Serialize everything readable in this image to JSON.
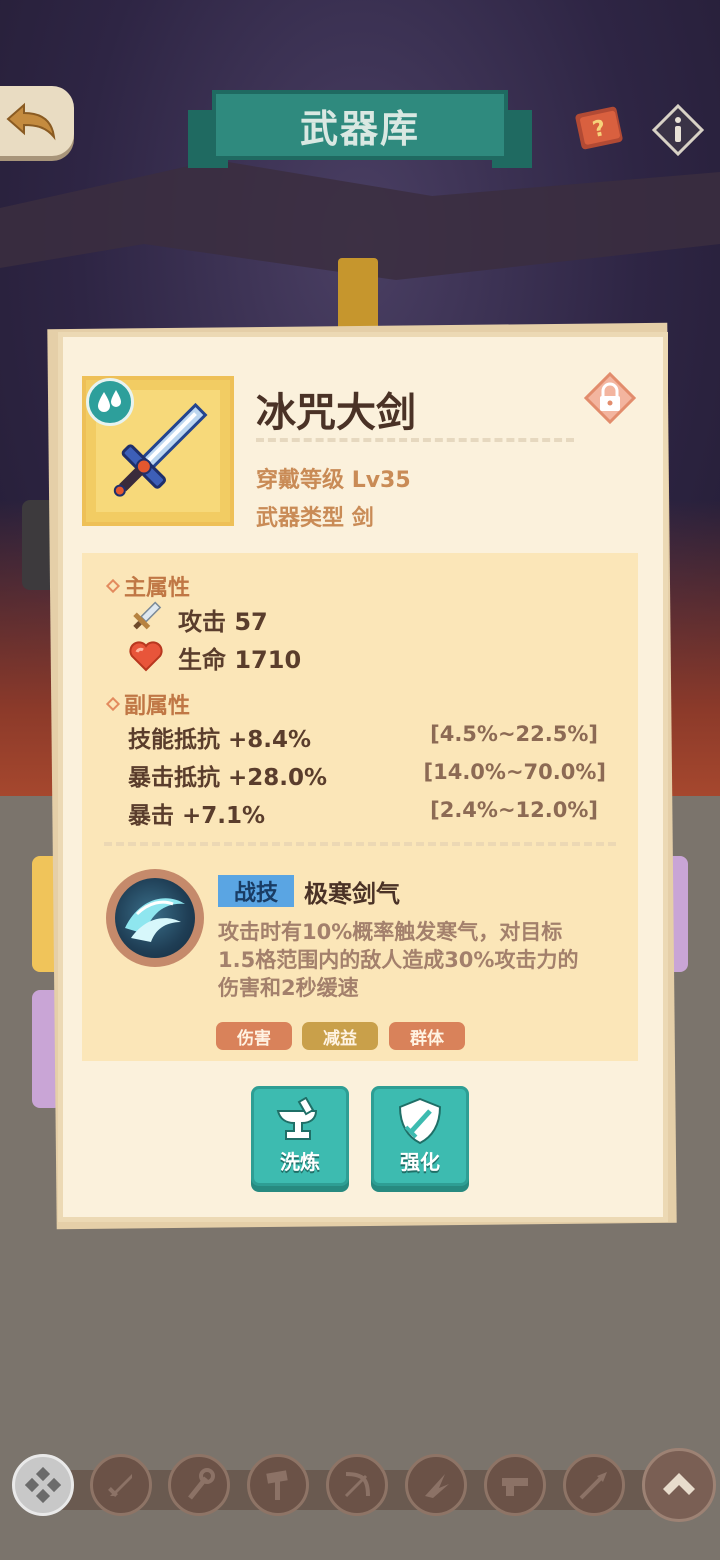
{
  "header": {
    "title": "武器库"
  },
  "weapon": {
    "name": "冰咒大剑",
    "element_icon": "water-drop-icon",
    "wear_level_label": "穿戴等级",
    "wear_level_value": "Lv35",
    "type_label": "武器类型",
    "type_value": "剑",
    "locked": true
  },
  "main_attributes": {
    "title": "主属性",
    "items": [
      {
        "icon": "sword-icon",
        "label": "攻击",
        "value": "57"
      },
      {
        "icon": "heart-icon",
        "label": "生命",
        "value": "1710"
      }
    ]
  },
  "sub_attributes": {
    "title": "副属性",
    "items": [
      {
        "label": "技能抵抗",
        "value": "+8.4%",
        "range": "[4.5%~22.5%]"
      },
      {
        "label": "暴击抵抗",
        "value": "+28.0%",
        "range": "[14.0%~70.0%]"
      },
      {
        "label": "暴击",
        "value": "+7.1%",
        "range": "[2.4%~12.0%]"
      }
    ]
  },
  "skill": {
    "tag": "战技",
    "name": "极寒剑气",
    "description": "攻击时有10%概率触发寒气，对目标1.5格范围内的敌人造成30%攻击力的伤害和2秒缓速",
    "tags": [
      {
        "label": "伤害",
        "color": "#d9825a"
      },
      {
        "label": "减益",
        "color": "#c9a04a"
      },
      {
        "label": "群体",
        "color": "#d9825a"
      }
    ]
  },
  "actions": {
    "reforge": "洗炼",
    "enhance": "强化"
  },
  "nav": [
    "all-weapons-icon",
    "sword-icon",
    "staff-icon",
    "hammer-icon",
    "bow-icon",
    "claw-icon",
    "gun-icon",
    "spear-icon",
    "collapse-icon"
  ],
  "colors": {
    "accent_teal": "#3dbbb0",
    "title_brown": "#4a3226",
    "label_orange": "#c98b56"
  }
}
